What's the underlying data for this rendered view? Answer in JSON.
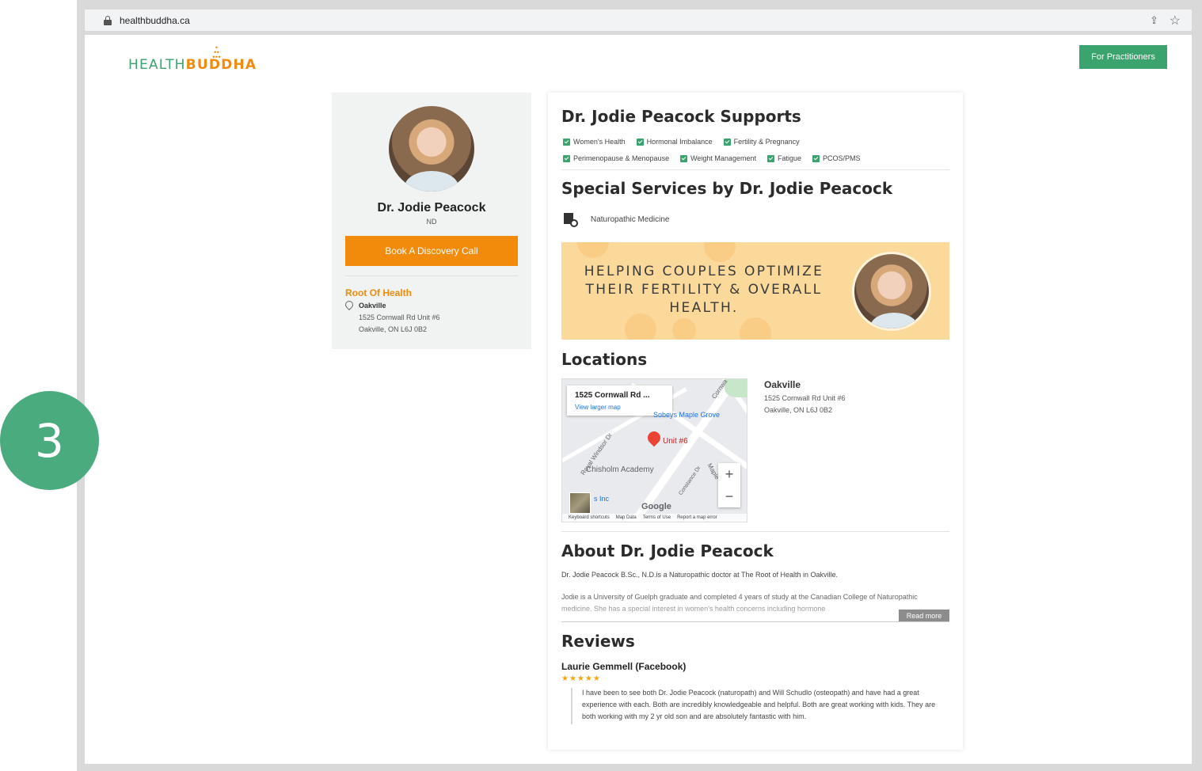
{
  "step": {
    "number": "3"
  },
  "browser": {
    "url": "healthbuddha.ca"
  },
  "header": {
    "logo_health": "HEALTH",
    "logo_buddha": "BUDDHA",
    "practitioners_button": "For Practitioners"
  },
  "profile": {
    "name": "Dr. Jodie Peacock",
    "credential": "ND",
    "book_button": "Book A Discovery Call",
    "clinic": "Root Of Health",
    "city": "Oakville",
    "address_line1": "1525 Cornwall Rd Unit #6",
    "address_line2": "Oakville, ON L6J 0B2"
  },
  "supports": {
    "heading": "Dr. Jodie Peacock Supports",
    "row1": [
      "Women's Health",
      "Hormonal Imbalance",
      "Fertility & Pregnancy"
    ],
    "row2": [
      "Perimenopause & Menopause",
      "Weight Management",
      "Fatigue",
      "PCOS/PMS"
    ]
  },
  "services": {
    "heading": "Special Services by Dr. Jodie Peacock",
    "items": [
      "Naturopathic Medicine"
    ],
    "banner_text": "HELPING COUPLES OPTIMIZE THEIR FERTILITY & OVERALL HEALTH."
  },
  "locations": {
    "heading": "Locations",
    "map": {
      "info_title": "1525 Cornwall Rd ...",
      "info_link": "View larger map",
      "pin_label": "Unit #6",
      "poi_grove": "Sobeys Maple Grove",
      "poi_academy": "Chisholm Academy",
      "poi_inc": "s Inc",
      "street_windsor": "Royal Windsor Dr",
      "street_cornwall": "Cornwa",
      "street_constance": "Constance Dr",
      "street_maple": "Maple",
      "google": "Google",
      "footer": [
        "Keyboard shortcuts",
        "Map Data",
        "Terms of Use",
        "Report a map error"
      ],
      "zoom_in": "+",
      "zoom_out": "−"
    },
    "city": "Oakville",
    "address_line1": "1525 Cornwall Rd Unit #6",
    "address_line2": "Oakville, ON L6J 0B2"
  },
  "about": {
    "heading": "About Dr. Jodie Peacock",
    "p1": "Dr. Jodie Peacock B.Sc., N.D.is a Naturopathic doctor at The Root of Health in Oakville.",
    "p2": "Jodie is a University of Guelph graduate and completed 4 years of study at the Canadian College of Naturopathic medicine. She has a special interest in women's health concerns including hormone",
    "read_more": "Read more"
  },
  "reviews": {
    "heading": "Reviews",
    "items": [
      {
        "author": "Laurie Gemmell (Facebook)",
        "stars": "★★★★★",
        "text": "I have been to see both Dr. Jodie Peacock (naturopath) and Will Schudlo (osteopath) and have had a great experience with each. Both are incredibly knowledgeable and helpful. Both are great working with kids. They are both working with my 2 yr old son and are absolutely fantastic with him."
      }
    ]
  }
}
